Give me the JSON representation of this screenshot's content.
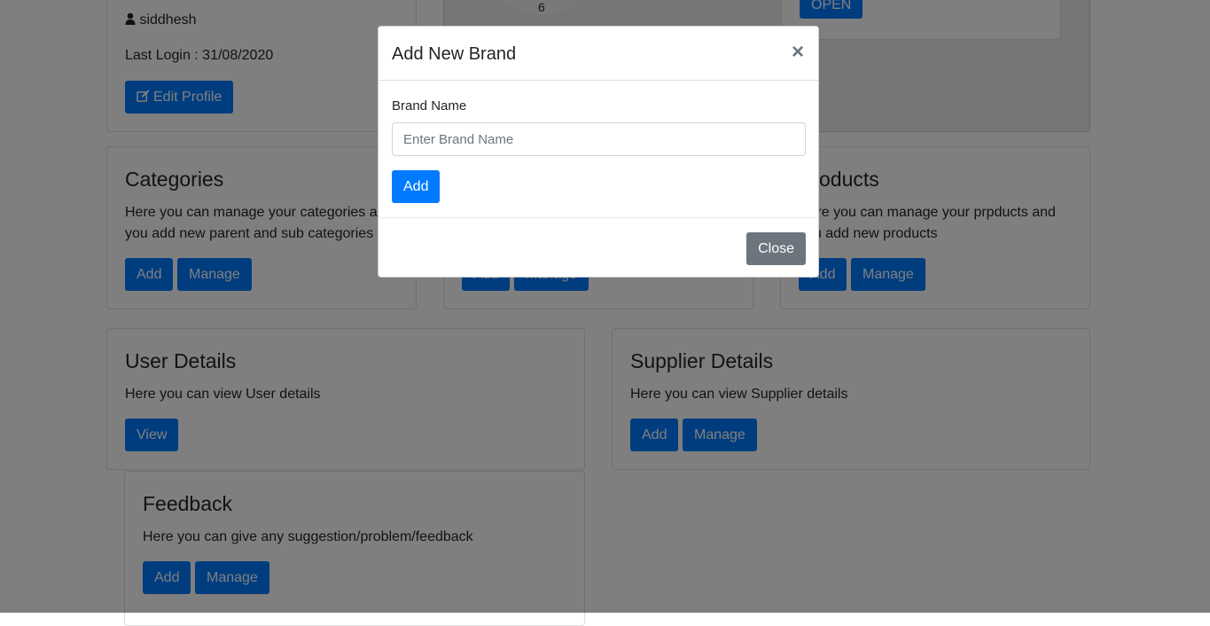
{
  "profile": {
    "username": "siddhesh",
    "last_login": "Last Login : 31/08/2020",
    "edit_label": "Edit Profile"
  },
  "clock": {
    "visible_numeral": "6"
  },
  "open_card": {
    "button_label": "OPEN"
  },
  "categories": {
    "title": "Categories",
    "description": "Here you can manage your categories and you add new parent and sub categories",
    "add_label": "Add",
    "manage_label": "Manage"
  },
  "brands_card": {
    "add_label": "Add",
    "manage_label": "Manage"
  },
  "products": {
    "title": "Products",
    "description": "Here you can manage your prpducts and you add new products",
    "add_label": "Add",
    "manage_label": "Manage"
  },
  "user_details": {
    "title": "User Details",
    "description": "Here you can view User details",
    "view_label": "View"
  },
  "supplier_details": {
    "title": "Supplier Details",
    "description": "Here you can view Supplier details",
    "add_label": "Add",
    "manage_label": "Manage"
  },
  "feedback": {
    "title": "Feedback",
    "description": "Here you can give any suggestion/problem/feedback",
    "add_label": "Add",
    "manage_label": "Manage"
  },
  "modal": {
    "title": "Add New Brand",
    "close_symbol": "×",
    "field_label": "Brand Name",
    "field_placeholder": "Enter Brand Name",
    "field_value": "",
    "add_label": "Add",
    "close_label": "Close"
  },
  "colors": {
    "primary": "#007bff",
    "secondary": "#6c757d",
    "backdrop": "rgba(0,0,0,0.5)"
  }
}
